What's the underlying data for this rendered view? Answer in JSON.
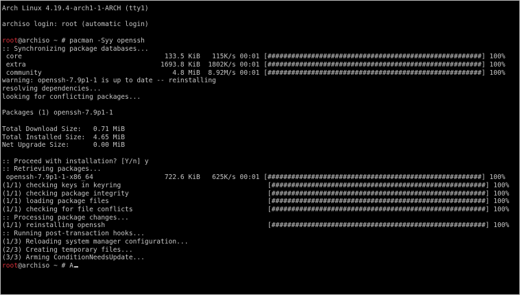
{
  "terminal": {
    "header": "Arch Linux 4.19.4-arch1-1-ARCH (tty1)",
    "login": "archiso login: root (automatic login)",
    "prompt_user": "root",
    "prompt_rest": "@archiso ~ # ",
    "command1": "pacman -Syy openssh",
    "sync_title": ":: Synchronizing package databases...",
    "db": [
      {
        "text": " core                                    133.5 KiB   115K/s 00:01 [######################################################] 100%"
      },
      {
        "text": " extra                                  1693.8 KiB  1802K/s 00:01 [######################################################] 100%"
      },
      {
        "text": " community                                 4.8 MiB  8.92M/s 00:01 [######################################################] 100%"
      }
    ],
    "warning": "warning: openssh-7.9p1-1 is up to date -- reinstalling",
    "resolving": "resolving dependencies...",
    "conflicts": "looking for conflicting packages...",
    "packages": "Packages (1) openssh-7.9p1-1",
    "sizes": [
      "Total Download Size:   0.71 MiB",
      "Total Installed Size:  4.65 MiB",
      "Net Upgrade Size:      0.00 MiB"
    ],
    "proceed": ":: Proceed with installation? [Y/n] y",
    "retrieving": ":: Retrieving packages...",
    "download": " openssh-7.9p1-1-x86_64                  722.6 KiB   625K/s 00:01 [######################################################] 100%",
    "checks": [
      "(1/1) checking keys in keyring                                     [######################################################] 100%",
      "(1/1) checking package integrity                                   [######################################################] 100%",
      "(1/1) loading package files                                        [######################################################] 100%",
      "(1/1) checking for file conflicts                                  [######################################################] 100%"
    ],
    "processing": ":: Processing package changes...",
    "reinstalling": "(1/1) reinstalling openssh                                         [######################################################] 100%",
    "hooks_title": ":: Running post-transaction hooks...",
    "hooks": [
      "(1/3) Reloading system manager configuration...",
      "(2/3) Creating temporary files...",
      "(3/3) Arming ConditionNeedsUpdate..."
    ],
    "final_input": "A"
  }
}
